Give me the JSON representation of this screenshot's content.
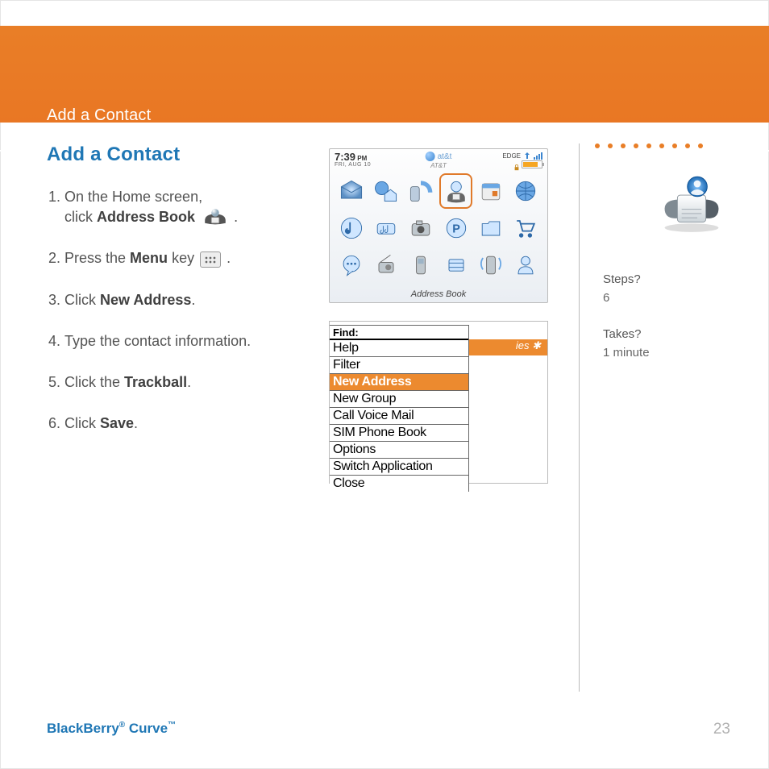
{
  "header": {
    "title": "Add a Contact"
  },
  "body": {
    "section_title": "Add a Contact"
  },
  "steps": [
    {
      "a": "On the Home screen,",
      "b": "click ",
      "bold": "Address Book",
      "end": " ."
    },
    {
      "a": "Press the ",
      "bold": "Menu",
      "b": " key ",
      "end": " ."
    },
    {
      "a": "Click ",
      "bold": "New Address",
      "end": "."
    },
    {
      "a": "Type the contact information."
    },
    {
      "a": "Click the ",
      "bold": "Trackball",
      "end": "."
    },
    {
      "a": "Click ",
      "bold": "Save",
      "end": "."
    }
  ],
  "device": {
    "time": "7:39",
    "ampm": " PM",
    "date": "FRI, AUG 10",
    "carrier": "at&t",
    "carrier_sub": "AT&T",
    "network": "EDGE",
    "caption": "Address Book"
  },
  "menu": {
    "find": "Find:",
    "bg_text": "ies ✱",
    "items": [
      "Help",
      "Filter",
      "New Address",
      "New Group",
      "Call Voice Mail",
      "SIM Phone Book",
      "Options",
      "Switch Application",
      "Close"
    ]
  },
  "sidebar": {
    "steps_label": "Steps?",
    "steps_value": "6",
    "takes_label": "Takes?",
    "takes_value": "1 minute"
  },
  "footer": {
    "brand_a": "BlackBerry",
    "reg": "®",
    "brand_b": "Curve",
    "tm": "™",
    "page": "23"
  }
}
